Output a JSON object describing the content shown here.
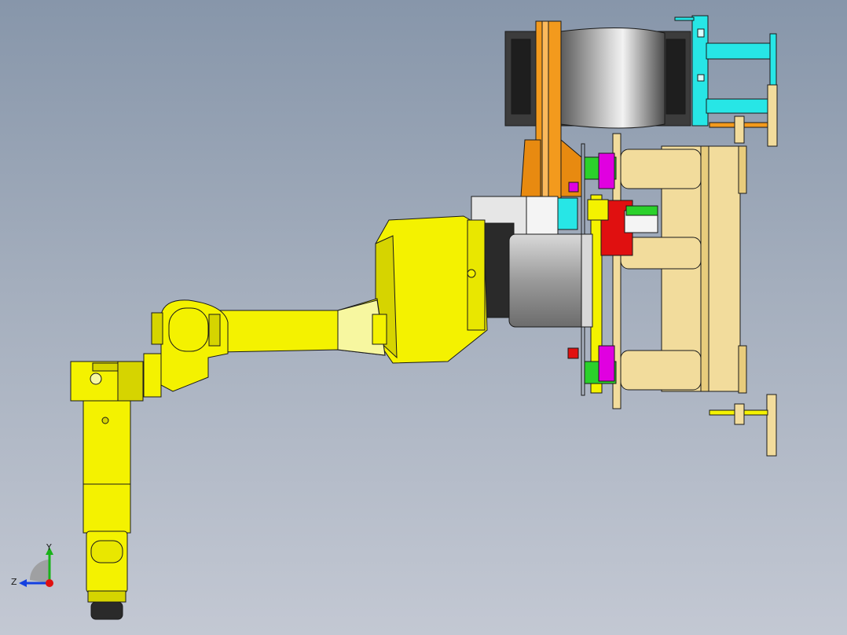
{
  "viewport": {
    "background_top": "#8796aa",
    "background_bottom": "#c3c8d3"
  },
  "colors": {
    "robot_yellow": "#f4f200",
    "robot_shade": "#d6d400",
    "robot_light": "#f7f7a0",
    "tan": "#f2dc9c",
    "orange": "#f39a1d",
    "cyan": "#27e6e6",
    "grey": "#8c8c8c",
    "magenta": "#e000e0",
    "green": "#2bd12b",
    "red": "#e01010",
    "outline": "#1a1a1a"
  },
  "triad": {
    "icon": "coordinate-triad-icon",
    "y_label": "Y",
    "z_label": "Z",
    "y_color": "#19b219",
    "z_color": "#1440e0",
    "x_color": "#e01010"
  }
}
